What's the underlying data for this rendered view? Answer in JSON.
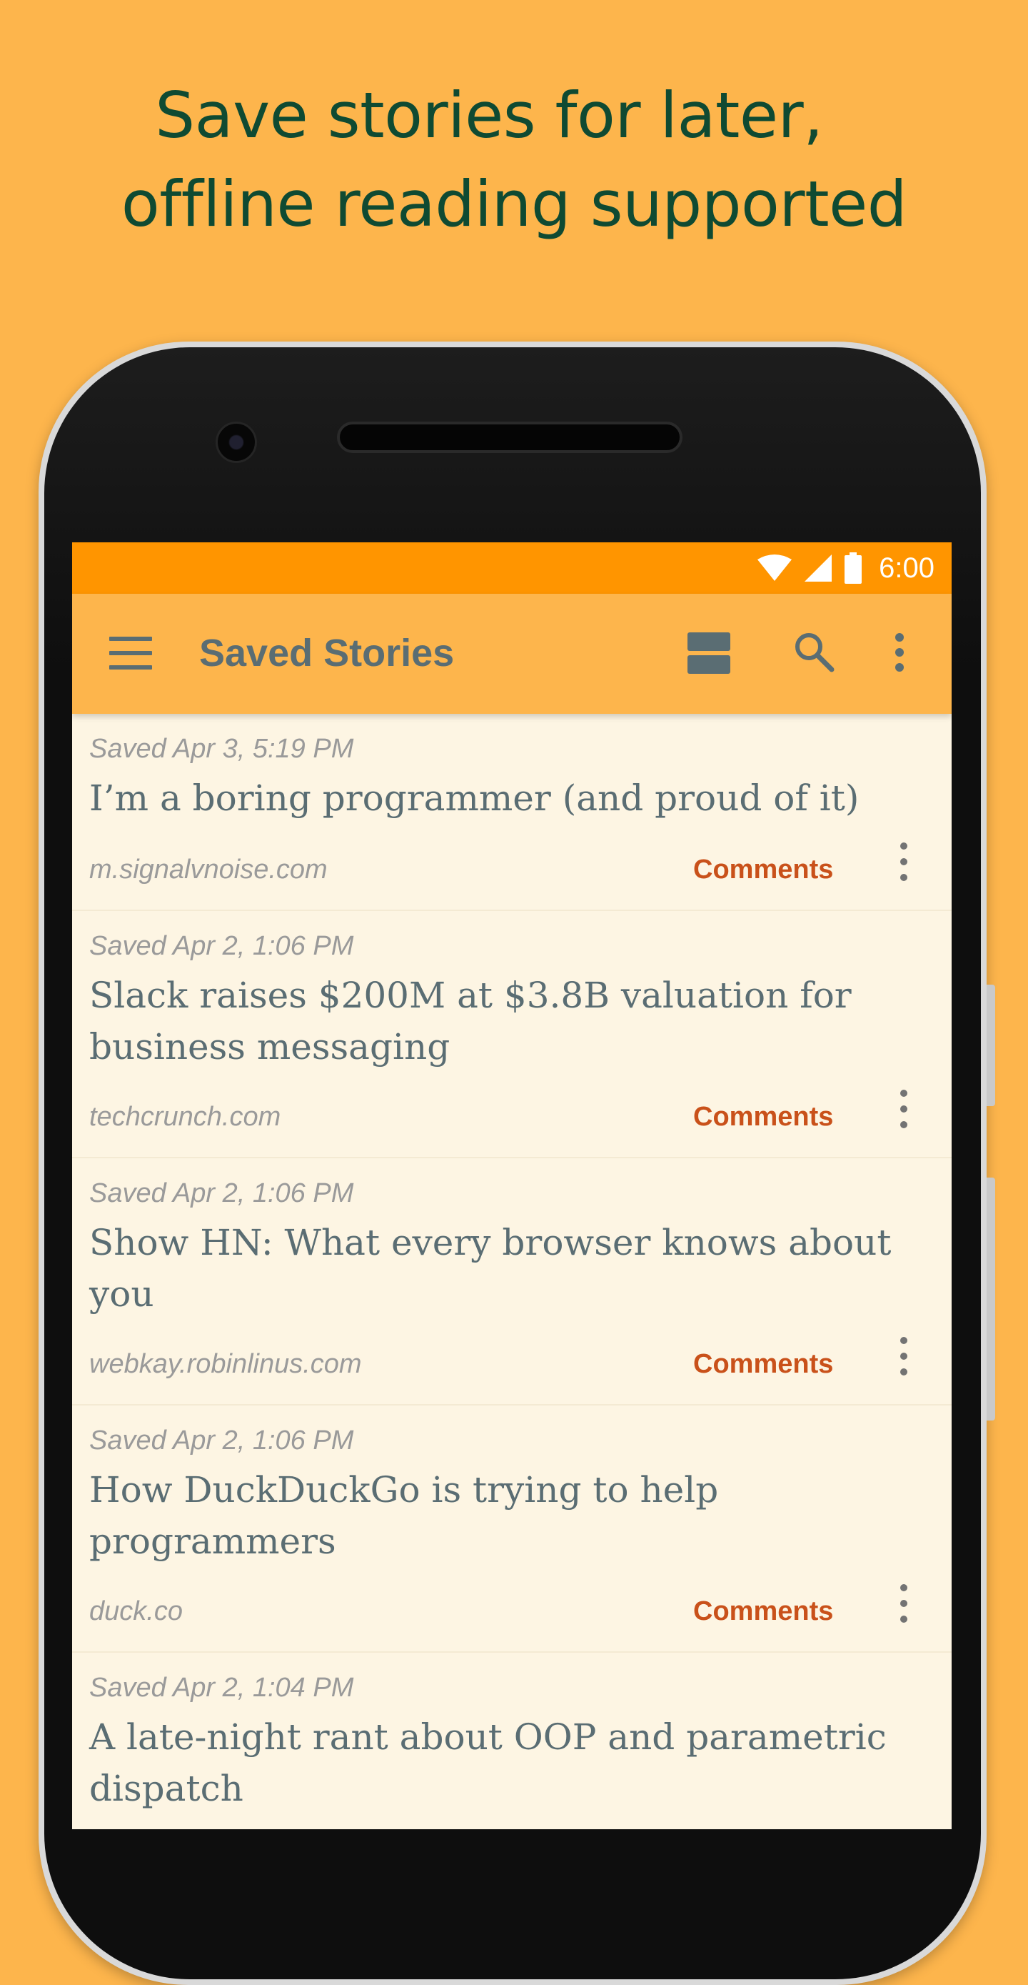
{
  "headline": {
    "line1": "Save stories for later,",
    "line2": "offline reading supported"
  },
  "status_bar": {
    "time": "6:00"
  },
  "toolbar": {
    "title": "Saved Stories"
  },
  "stories": [
    {
      "saved": "Saved Apr 3, 5:19 PM",
      "title": "I’m a boring programmer (and proud of it)",
      "domain": "m.signalvnoise.com",
      "comments": "Comments"
    },
    {
      "saved": "Saved Apr 2, 1:06 PM",
      "title": "Slack raises $200M at $3.8B valuation for business messaging",
      "domain": "techcrunch.com",
      "comments": "Comments"
    },
    {
      "saved": "Saved Apr 2, 1:06 PM",
      "title": "Show HN: What every browser knows about you",
      "domain": "webkay.robinlinus.com",
      "comments": "Comments"
    },
    {
      "saved": "Saved Apr 2, 1:06 PM",
      "title": "How DuckDuckGo is trying to help programmers",
      "domain": "duck.co",
      "comments": "Comments"
    },
    {
      "saved": "Saved Apr 2, 1:04 PM",
      "title": "A late-night rant about OOP and parametric dispatch",
      "domain": "",
      "comments": ""
    }
  ],
  "colors": {
    "background": "#FDB54C",
    "status_bar": "#FF9500",
    "headline": "#0F4A32",
    "comments": "#C9511A",
    "text": "#5A6D73"
  }
}
